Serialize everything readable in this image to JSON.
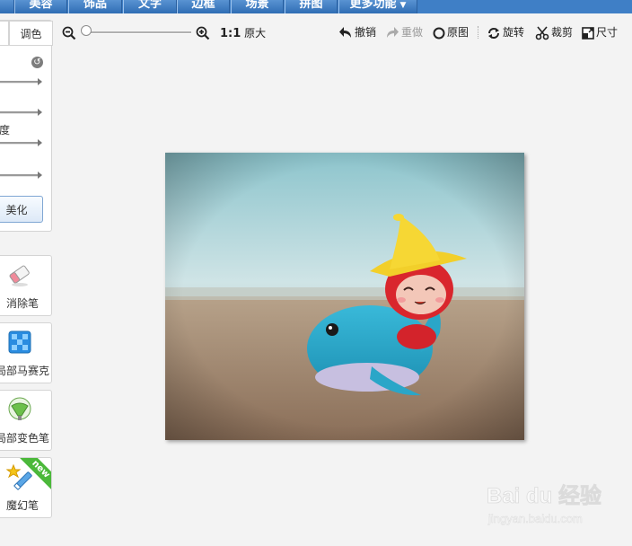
{
  "nav": {
    "tabs": [
      {
        "label": "美容"
      },
      {
        "label": "饰品"
      },
      {
        "label": "文字"
      },
      {
        "label": "边框"
      },
      {
        "label": "场景"
      },
      {
        "label": "拼图"
      },
      {
        "label": "更多功能",
        "has_caret": true
      }
    ]
  },
  "left_panel": {
    "subtab_right": "调色",
    "slider_labels": [
      "度"
    ],
    "beautify_button": "美化",
    "tools": [
      {
        "label": "消除笔",
        "icon": "eraser-icon"
      },
      {
        "label": "局部马赛克",
        "icon": "mosaic-icon"
      },
      {
        "label": "局部变色笔",
        "icon": "color-pen-icon"
      },
      {
        "label": "魔幻笔",
        "icon": "magic-pen-icon",
        "badge": "new"
      }
    ]
  },
  "toolbar": {
    "zoom_ratio": "1:1",
    "original_size": "原大",
    "undo": "撤销",
    "redo": "重做",
    "original": "原图",
    "rotate": "旋转",
    "crop": "裁剪",
    "size": "尺寸"
  },
  "watermark": {
    "brand": "Bai du 经验",
    "url": "jingyan.baidu.com"
  },
  "colors": {
    "nav_blue": "#3f7fc6",
    "background": "#f3f3f3"
  }
}
